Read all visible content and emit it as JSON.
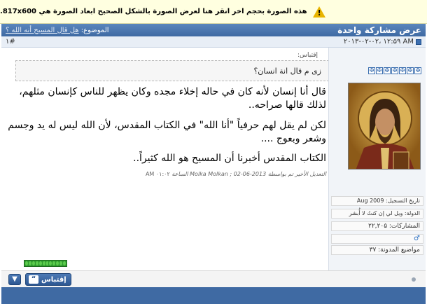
{
  "notice": {
    "text": "هذه الصورة بحجم اخر انقر هنا لعرض الصورة بالشكل الصحيح ابعاد الصورة هي 817x600.",
    "icon": "warning-icon"
  },
  "thread": {
    "title": "عرض مشاركة واحدة",
    "subject_label": "الموضوع:",
    "subject_link": "هل قال المسيح أنه الله ؟"
  },
  "post": {
    "date": "۲۰۱۳-۰۲-۰۲، ۱۲:۵۹ AM",
    "number": "۱#",
    "quote_label": "إقتباس:",
    "quote_text": "زى م قال انة انسان؟",
    "paragraph1": "قال أنا إنسان لأنه كان في حاله إخلاء مجده وكان يظهر للناس كإنسان مثلهم، لذلك قالها صراحه..",
    "paragraph2": "لكن لم يقل لهم حرفياً \"أنا الله\" في الكتاب المقدس، لأن الله ليس له يد وجسم وشعر وبعوج ....",
    "paragraph3": "الكتاب المقدس أخبرنا أن المسيح هو الله كثيراً..",
    "edited_prefix": "التعديل الأخير تم بواسطة Molka Molkan ; 02-06-2013 الساعة",
    "edited_time": "۰۱:۰۲ AM"
  },
  "user": {
    "registration": "تاريخ التسجيل: Aug 2009",
    "country": "الدولة: ويل لي إن كنتُ لا أُبشر",
    "posts": "المشاركات: ۲۲,۲۰۵",
    "blog": "مواضيع المدونة: ۳۷",
    "gender_icon": "male-icon"
  },
  "actions": {
    "quote_label": "إقتباس",
    "quote_icon": "quote-icon",
    "multiquote_icon": "multiquote-icon"
  },
  "colors": {
    "header_blue": "#3f6aa3",
    "notice_yellow": "#ffffe0",
    "rep_green": "#2f9a2f"
  }
}
